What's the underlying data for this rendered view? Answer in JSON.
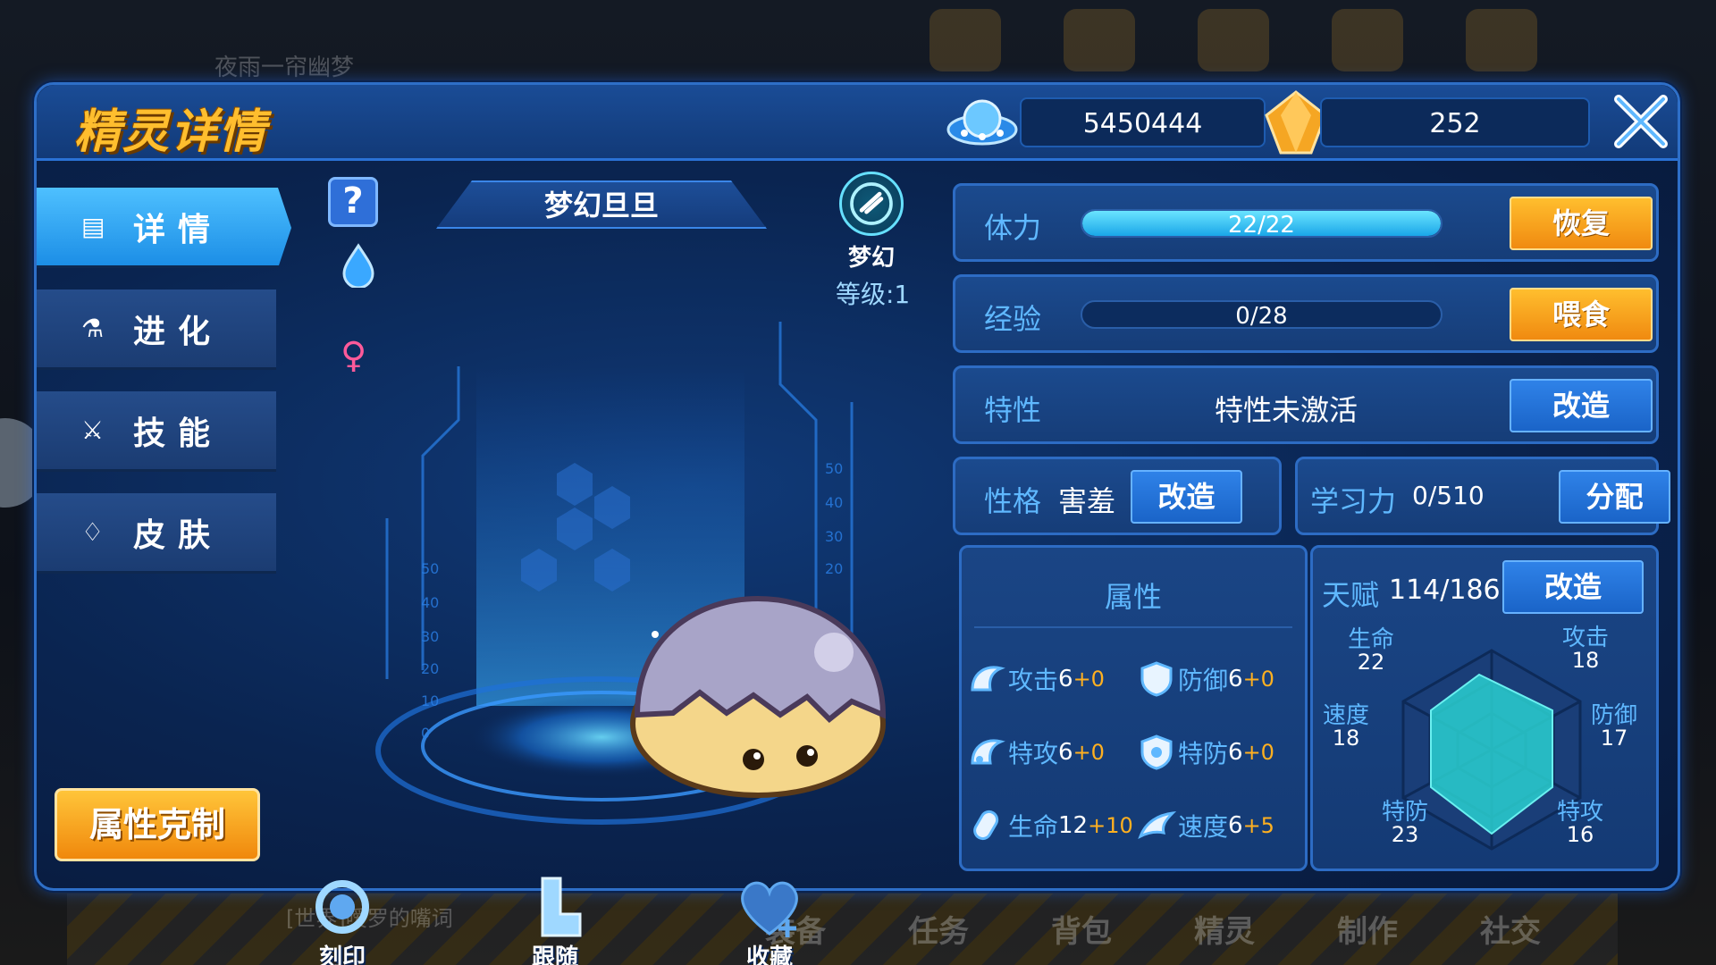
{
  "background": {
    "player_name": "夜雨一帘幽梦",
    "chat_text": "[世界]嗳罗的嘴词",
    "bottom_nav": [
      "装备",
      "任务",
      "背包",
      "精灵",
      "制作",
      "社交"
    ]
  },
  "header": {
    "title": "精灵详情",
    "coins": "5450444",
    "gems": "252"
  },
  "nav": {
    "items": [
      {
        "icon": "detail-icon",
        "label": "详情",
        "active": true
      },
      {
        "icon": "flask-icon",
        "label": "进化",
        "active": false
      },
      {
        "icon": "skill-icon",
        "label": "技能",
        "active": false
      },
      {
        "icon": "drop-icon",
        "label": "皮肤",
        "active": false
      }
    ],
    "restrain_button": "属性克制"
  },
  "pet": {
    "name": "梦幻旦旦",
    "type_label": "梦幻",
    "level": "等级:1",
    "gender": "♀",
    "help": "?"
  },
  "actions": {
    "imprint": "刻印",
    "follow": "跟随",
    "favorite": "收藏"
  },
  "stats_top": {
    "stamina_label": "体力",
    "stamina_text": "22/22",
    "stamina_ratio": 1.0,
    "restore_button": "恢复",
    "exp_label": "经验",
    "exp_text": "0/28",
    "exp_ratio": 0.0,
    "feed_button": "喂食",
    "trait_label": "特性",
    "trait_value": "特性未激活",
    "trait_button": "改造",
    "nature_label": "性格",
    "nature_value": "害羞",
    "nature_button": "改造",
    "learn_label": "学习力",
    "learn_value": "0/510",
    "learn_button": "分配"
  },
  "attributes": {
    "title": "属性",
    "items": [
      {
        "name": "攻击",
        "base": "6",
        "bonus": "+0"
      },
      {
        "name": "防御",
        "base": "6",
        "bonus": "+0"
      },
      {
        "name": "特攻",
        "base": "6",
        "bonus": "+0"
      },
      {
        "name": "特防",
        "base": "6",
        "bonus": "+0"
      },
      {
        "name": "生命",
        "base": "12",
        "bonus": "+10"
      },
      {
        "name": "速度",
        "base": "6",
        "bonus": "+5"
      }
    ]
  },
  "talent": {
    "label": "天赋",
    "value": "114/186",
    "button": "改造",
    "radar": [
      {
        "name": "生命",
        "value": "22"
      },
      {
        "name": "攻击",
        "value": "18"
      },
      {
        "name": "防御",
        "value": "17"
      },
      {
        "name": "特攻",
        "value": "16"
      },
      {
        "name": "特防",
        "value": "23"
      },
      {
        "name": "速度",
        "value": "18"
      }
    ]
  },
  "colors": {
    "accent_blue": "#5fb8ff",
    "orange": "#f08a10",
    "gold_title": "#ffbe2e",
    "radar_fill": "#2ad0d0"
  }
}
